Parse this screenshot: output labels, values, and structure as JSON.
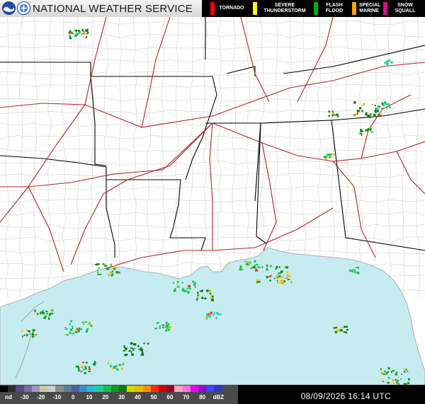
{
  "header": {
    "title": "NATIONAL WEATHER SERVICE",
    "logos": [
      "noaa-logo",
      "nws-logo"
    ]
  },
  "warnings_legend": [
    {
      "label": "TORNADO",
      "color": "#ff0000"
    },
    {
      "label": "SEVERE\nTHUNDERSTORM",
      "color": "#ffff00"
    },
    {
      "label": "FLASH\nFLOOD",
      "color": "#00b000"
    },
    {
      "label": "SPECIAL\nMARINE",
      "color": "#ffa500"
    },
    {
      "label": "SNOW\nSQUALL",
      "color": "#c71585"
    }
  ],
  "colorbar": {
    "unit": "dBZ",
    "labels": [
      "nd",
      "-30",
      "-20",
      "-10",
      "0",
      "10",
      "20",
      "30",
      "40",
      "50",
      "60",
      "70",
      "80"
    ],
    "colors": [
      "#000000",
      "#2a2a2a",
      "#584a84",
      "#7a66a8",
      "#9c94c0",
      "#c8c8a8",
      "#cccccc",
      "#8c8c8c",
      "#5e7e96",
      "#4a5ea0",
      "#3a8ec8",
      "#2ab8d0",
      "#1ad0a0",
      "#16c050",
      "#0a9a1e",
      "#0c7a12",
      "#d8d800",
      "#e8b800",
      "#ff8c00",
      "#ff2a00",
      "#cc0000",
      "#a0001e",
      "#ffa0c8",
      "#ff70d8",
      "#ee00ee",
      "#a000c8",
      "#4040ff",
      "#2a3cc8"
    ]
  },
  "timestamp": "08/09/2026 16:14 UTC",
  "map": {
    "water_color": "#c6ecf2",
    "land_color": "#ffffff",
    "state_border_color": "#000000",
    "county_line_color": "#c8c8c8",
    "highway_color": "#b0231f"
  }
}
